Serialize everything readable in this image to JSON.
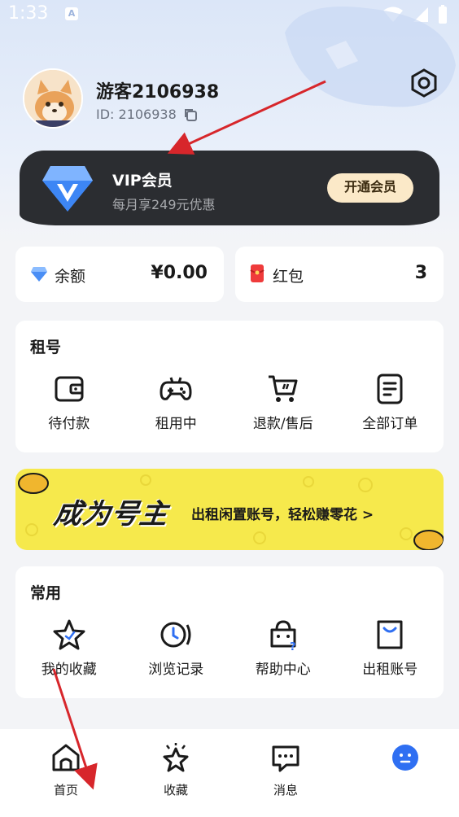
{
  "status_bar": {
    "time": "1:33",
    "a_badge": "A"
  },
  "profile": {
    "username": "游客2106938",
    "user_id": "ID: 2106938"
  },
  "vip": {
    "title": "VIP会员",
    "subtitle": "每月享249元优惠",
    "button_label": "开通会员"
  },
  "wallet": {
    "balance_label": "余额",
    "balance_value": "¥0.00",
    "redpacket_label": "红包",
    "redpacket_value": "3"
  },
  "rental": {
    "title": "租号",
    "items": [
      {
        "label": "待付款",
        "icon": "wallet-icon"
      },
      {
        "label": "租用中",
        "icon": "gamepad-icon"
      },
      {
        "label": "退款/售后",
        "icon": "cart-icon"
      },
      {
        "label": "全部订单",
        "icon": "order-list-icon"
      }
    ]
  },
  "banner": {
    "title": "成为号主",
    "subtitle": "出租闲置账号，轻松赚零花 >"
  },
  "common": {
    "title": "常用",
    "items": [
      {
        "label": "我的收藏",
        "icon": "star-icon"
      },
      {
        "label": "浏览记录",
        "icon": "history-icon"
      },
      {
        "label": "帮助中心",
        "icon": "help-center-icon"
      },
      {
        "label": "出租账号",
        "icon": "bag-icon"
      }
    ]
  },
  "bottom_nav": [
    {
      "label": "首页",
      "icon": "home-icon"
    },
    {
      "label": "收藏",
      "icon": "star-outline-icon"
    },
    {
      "label": "消息",
      "icon": "message-icon"
    },
    {
      "label": "",
      "icon": "profile-face-icon",
      "active": true
    }
  ],
  "colors": {
    "accent_blue": "#2f6ff2",
    "vip_bg": "#2b2d31",
    "vip_btn": "#fbe9c8",
    "banner": "#f6e94c",
    "arrow": "#d7262b"
  }
}
